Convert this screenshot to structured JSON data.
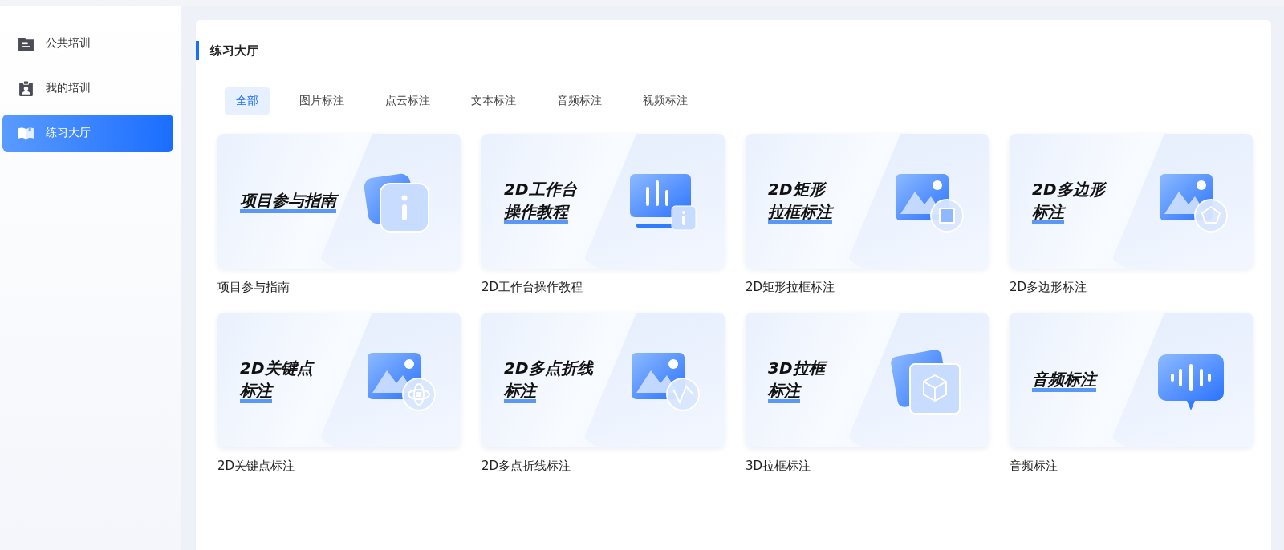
{
  "sidebar": {
    "items": [
      {
        "label": "公共培训",
        "selected": false
      },
      {
        "label": "我的培训",
        "selected": false
      },
      {
        "label": "练习大厅",
        "selected": true
      }
    ]
  },
  "page_title": "练习大厅",
  "tabs": [
    {
      "label": "全部",
      "selected": true
    },
    {
      "label": "图片标注",
      "selected": false
    },
    {
      "label": "点云标注",
      "selected": false
    },
    {
      "label": "文本标注",
      "selected": false
    },
    {
      "label": "音频标注",
      "selected": false
    },
    {
      "label": "视频标注",
      "selected": false
    }
  ],
  "cards": [
    {
      "kind": "info",
      "cover_lines": [
        "项目参与指南"
      ],
      "caption": "项目参与指南"
    },
    {
      "kind": "chart",
      "cover_lines": [
        "2D工作台",
        "操作教程"
      ],
      "caption": "2D工作台操作教程"
    },
    {
      "kind": "rect",
      "cover_lines": [
        "2D矩形",
        "拉框标注"
      ],
      "caption": "2D矩形拉框标注"
    },
    {
      "kind": "polygon",
      "cover_lines": [
        "2D多边形",
        "标注"
      ],
      "caption": "2D多边形标注"
    },
    {
      "kind": "keypoint",
      "cover_lines": [
        "2D关键点",
        "标注"
      ],
      "caption": "2D关键点标注"
    },
    {
      "kind": "polyline",
      "cover_lines": [
        "2D多点折线",
        "标注"
      ],
      "caption": "2D多点折线标注"
    },
    {
      "kind": "cube",
      "cover_lines": [
        "3D拉框",
        "标注"
      ],
      "caption": "3D拉框标注"
    },
    {
      "kind": "audio",
      "cover_lines": [
        "音频标注"
      ],
      "caption": "音频标注"
    }
  ]
}
